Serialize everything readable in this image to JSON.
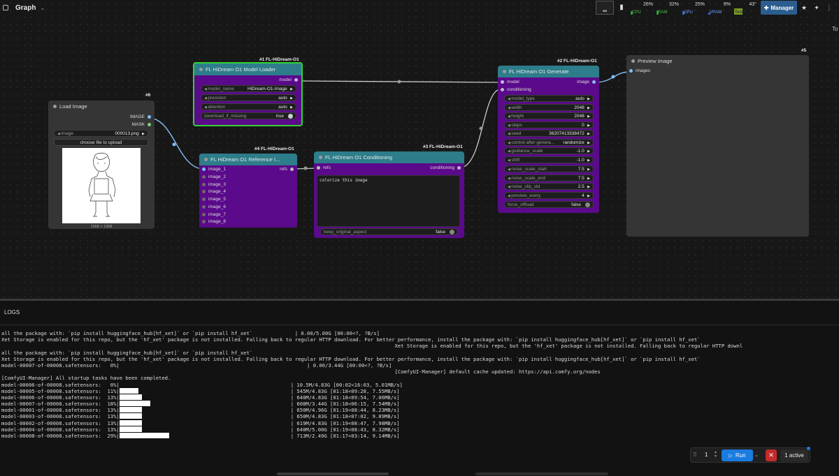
{
  "topbar": {
    "graph_label": "Graph",
    "monitors": [
      {
        "label": "CPU",
        "value": "26%",
        "level": 0.26,
        "color": "green"
      },
      {
        "label": "RAM",
        "value": "32%",
        "level": 0.32,
        "color": "green"
      },
      {
        "label": "GPU",
        "value": "25%",
        "level": 0.25,
        "color": "blue"
      },
      {
        "label": "VRAM",
        "value": "9%",
        "level": 0.09,
        "color": "blue"
      },
      {
        "label": "Temp",
        "value": "43°",
        "level": 0.43,
        "color": "olive"
      }
    ],
    "manager_label": "Manager",
    "truncated_label": "To"
  },
  "nodes": {
    "model_loader": {
      "id": "#1 FL-HiDream-O1",
      "title": "FL HiDream O1 Model Loader",
      "output": "model",
      "widgets": [
        {
          "label": "model_name",
          "value": "HiDream-O1-Image"
        },
        {
          "label": "precision",
          "value": "auto"
        },
        {
          "label": "attention",
          "value": "auto"
        },
        {
          "label": "download_if_missing",
          "value": "true"
        }
      ]
    },
    "load_image": {
      "id": "#6",
      "title": "Load Image",
      "outputs": [
        "IMAGE",
        "MASK"
      ],
      "image_label": "image",
      "image_value": "000013.png",
      "upload_label": "choose file to upload",
      "size_label": "1368 × 1368"
    },
    "reference": {
      "id": "#4 FL-HiDream-O1",
      "title": "FL HiDream O1 Reference I...",
      "inputs": [
        "image_1",
        "image_2",
        "image_3",
        "image_4",
        "image_5",
        "image_6",
        "image_7",
        "image_8"
      ],
      "output": "refs"
    },
    "conditioning": {
      "id": "#3 FL-HiDream-O1",
      "title": "FL HiDream O1 Conditioning",
      "input": "refs",
      "output": "conditioning",
      "prompt": "colorize this image",
      "toggle_label": "keep_original_aspect",
      "toggle_value": "false"
    },
    "generate": {
      "id": "#2 FL-HiDream-O1",
      "title": "FL HiDream O1 Generate",
      "inputs": [
        "model",
        "conditioning"
      ],
      "output": "image",
      "widgets": [
        {
          "label": "model_type",
          "value": "auto"
        },
        {
          "label": "width",
          "value": "2048"
        },
        {
          "label": "height",
          "value": "2048"
        },
        {
          "label": "steps",
          "value": "0"
        },
        {
          "label": "seed",
          "value": "36207413338472"
        },
        {
          "label": "control after genera...",
          "value": "randomize"
        },
        {
          "label": "guidance_scale",
          "value": "-1.0"
        },
        {
          "label": "shift",
          "value": "-1.0"
        },
        {
          "label": "noise_scale_start",
          "value": "7.5"
        },
        {
          "label": "noise_scale_end",
          "value": "7.5"
        },
        {
          "label": "noise_clip_std",
          "value": "2.5"
        },
        {
          "label": "preview_every",
          "value": "4"
        },
        {
          "label": "force_offload",
          "value": "false"
        }
      ]
    },
    "preview": {
      "id": "#5",
      "title": "Preview Image",
      "input": "images"
    }
  },
  "logs": {
    "title": "LOGS",
    "lines": [
      {
        "text": "all the package with: `pip install huggingface_hub[hf_xet]` or `pip install hf_xet`              | 0.00/5.00G [00:00<?, ?B/s]"
      },
      {
        "text": "Xet Storage is enabled for this repo, but the 'hf_xet' package is not installed. Falling back to regular HTTP download. For better performance, install the package with: `pip install huggingface_hub[hf_xet]` or `pip install hf_xet`"
      },
      {
        "text": "                                                                                                                                  Xet Storage is enabled for this repo, but the 'hf_xet' package is not installed. Falling back to regular HTTP downl"
      },
      {
        "text": "all the package with: `pip install huggingface_hub[hf_xet]` or `pip install hf_xet`"
      },
      {
        "text": "Xet Storage is enabled for this repo, but the 'hf_xet' package is not installed. Falling back to regular HTTP download. For better performance, install the package with: `pip install huggingface_hub[hf_xet]` or `pip install hf_xet`"
      },
      {
        "text": "model-00007-of-00008.safetensors:   0%|                                                              | 0.00/3.44G [00:00<?, ?B/s]"
      },
      {
        "text": "                                                                                                                                  [ComfyUI-Manager] default cache updated: https://api.comfy.org/nodes"
      },
      {
        "text": "[ComfyUI-Manager] All startup tasks have been completed."
      },
      {
        "text": "model-00006-of-00008.safetensors:   0%|",
        "bar": 0,
        "stats": "| 10.5M/4.83G [00:02<16:03, 5.01MB/s]"
      },
      {
        "text": "model-00005-of-00008.safetensors:  11%|",
        "bar": 0.11,
        "stats": "| 545M/4.83G [01:18<09:28, 7.55MB/s]"
      },
      {
        "text": "model-00006-of-00008.safetensors:  13%|",
        "bar": 0.13,
        "stats": "| 640M/4.83G [01:18<09:54, 7.06MB/s]"
      },
      {
        "text": "model-00007-of-00008.safetensors:  18%|",
        "bar": 0.18,
        "stats": "| 608M/3.44G [01:18<06:15, 7.54MB/s]"
      },
      {
        "text": "model-00001-of-00008.safetensors:  13%|",
        "bar": 0.13,
        "stats": "| 650M/4.96G [01:19<08:44, 8.23MB/s]"
      },
      {
        "text": "model-00003-of-00008.safetensors:  13%|",
        "bar": 0.13,
        "stats": "| 650M/4.83G [01:18<07:02, 9.89MB/s]"
      },
      {
        "text": "model-00002-of-00008.safetensors:  13%|",
        "bar": 0.13,
        "stats": "| 619M/4.83G [01:19<08:47, 7.98MB/s]"
      },
      {
        "text": "model-00004-of-00008.safetensors:  13%|",
        "bar": 0.13,
        "stats": "| 640M/5.00G [01:19<08:43, 8.32MB/s]"
      },
      {
        "text": "model-00008-of-00008.safetensors:  29%|",
        "bar": 0.29,
        "stats": "| 713M/2.49G [01:17<03:14, 9.14MB/s]"
      }
    ]
  },
  "runbar": {
    "count": "1",
    "run_label": "Run",
    "active_label": "1 active"
  }
}
